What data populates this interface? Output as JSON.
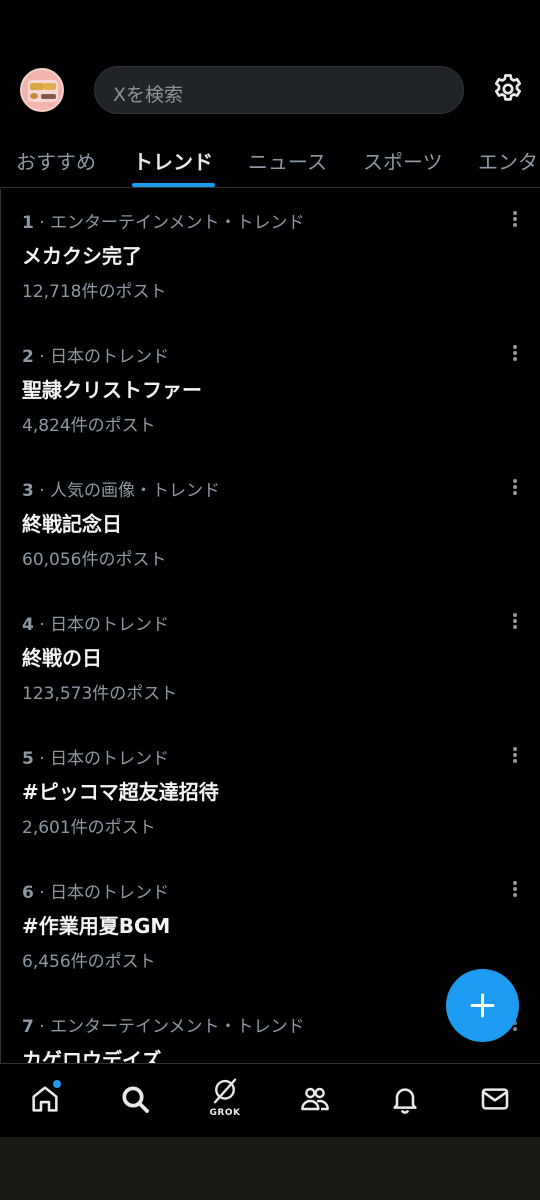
{
  "search": {
    "placeholder": "Xを検索"
  },
  "tabs": [
    {
      "label": "おすすめ",
      "active": false
    },
    {
      "label": "トレンド",
      "active": true
    },
    {
      "label": "ニュース",
      "active": false
    },
    {
      "label": "スポーツ",
      "active": false
    },
    {
      "label": "エンタ",
      "active": false
    }
  ],
  "trends": [
    {
      "rank": "1",
      "category": "エンターテインメント・トレンド",
      "name": "メカクシ完了",
      "posts": "12,718件のポスト"
    },
    {
      "rank": "2",
      "category": "日本のトレンド",
      "name": "聖隷クリストファー",
      "posts": "4,824件のポスト"
    },
    {
      "rank": "3",
      "category": "人気の画像・トレンド",
      "name": "終戦記念日",
      "posts": "60,056件のポスト"
    },
    {
      "rank": "4",
      "category": "日本のトレンド",
      "name": "終戦の日",
      "posts": "123,573件のポスト"
    },
    {
      "rank": "5",
      "category": "日本のトレンド",
      "name": "#ピッコマ超友達招待",
      "posts": "2,601件のポスト"
    },
    {
      "rank": "6",
      "category": "日本のトレンド",
      "name": "#作業用夏BGM",
      "posts": "6,456件のポスト"
    },
    {
      "rank": "7",
      "category": "エンターテインメント・トレンド",
      "name": "カゲロウデイズ",
      "posts": ""
    }
  ],
  "nav": {
    "grok_label": "GROK",
    "items": [
      "home-icon",
      "search-icon",
      "grok-icon",
      "communities-icon",
      "notifications-icon",
      "messages-icon"
    ]
  },
  "colors": {
    "accent": "#1d9bf0",
    "background": "#000000",
    "muted": "#8b98a5"
  }
}
